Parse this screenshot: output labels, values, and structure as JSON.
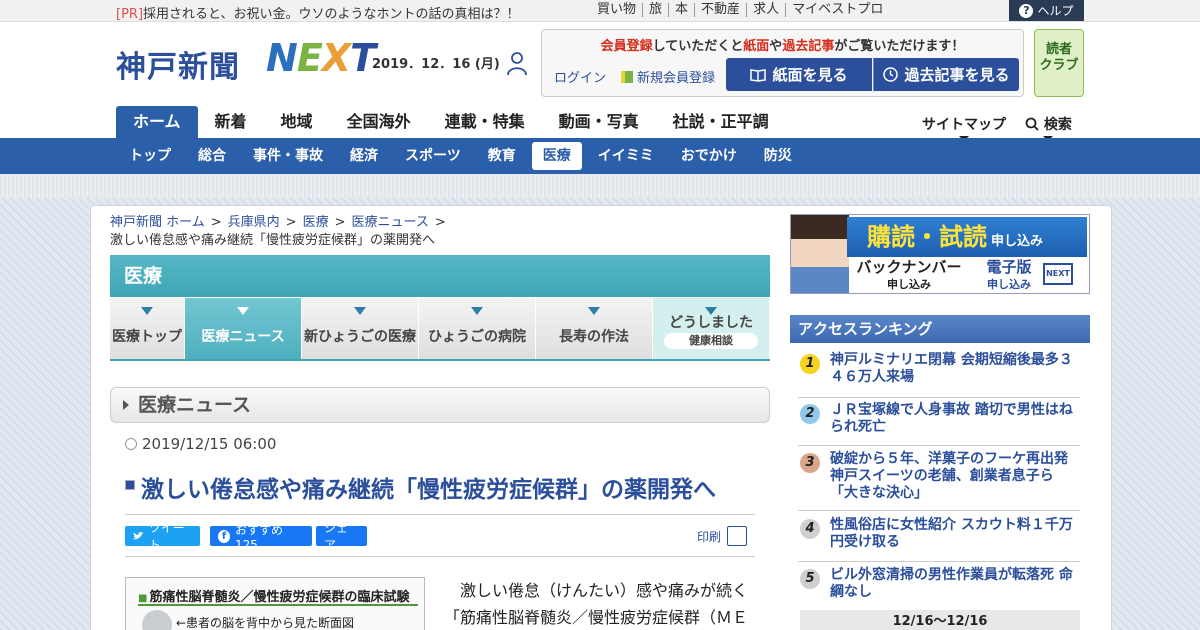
{
  "topbar": {
    "pr_tag": "[PR]",
    "pr_text": "採用されると、お祝い金。ウソのようなホントの話の真相は？！",
    "links": [
      "買い物",
      "旅",
      "本",
      "不動産",
      "求人",
      "マイベストプロ"
    ],
    "help": "ヘルプ"
  },
  "header": {
    "logo_text": "神戸新聞",
    "logo_next": {
      "n": "N",
      "e": "E",
      "x": "X",
      "t": "T"
    },
    "date": "2019．12．16 (月)",
    "member_msg": {
      "a": "会員登録",
      "b": "していただくと",
      "c": "紙面",
      "d": "や",
      "e": "過去記事",
      "f": "がご覧いただけます！"
    },
    "login": "ログイン",
    "register": "新規会員登録",
    "btn_paper": "紙面を見る",
    "btn_past": "過去記事を見る",
    "reader_club_1": "読者",
    "reader_club_2": "クラブ"
  },
  "mainnav": [
    "ホーム",
    "新着",
    "地域",
    "全国海外",
    "連載・特集",
    "動画・写真",
    "社説・正平調"
  ],
  "util": {
    "sitemap": "サイトマップ",
    "search": "検索"
  },
  "subnav": [
    "トップ",
    "総合",
    "事件・事故",
    "経済",
    "スポーツ",
    "教育",
    "医療",
    "イイミミ",
    "おでかけ",
    "防災"
  ],
  "breadcrumb": {
    "items": [
      "神戸新聞 ホーム",
      "兵庫県内",
      "医療",
      "医療ニュース"
    ],
    "sep": ">",
    "current": "激しい倦怠感や痛み継続「慢性疲労症候群」の薬開発へ"
  },
  "section_title": "医療",
  "subtabs": [
    "医療トップ",
    "医療ニュース",
    "新ひょうごの医療",
    "ひょうごの病院",
    "長寿の作法"
  ],
  "consult": {
    "main": "どうしました",
    "small": "健康相談"
  },
  "news_head": "医療ニュース",
  "article": {
    "timestamp": "2019/12/15 06:00",
    "headline": "激しい倦怠感や痛み継続「慢性疲労症候群」の薬開発へ",
    "share_tweet": "ツイート",
    "share_fb": "おすすめ 125",
    "share_fb_icon": "f",
    "share_share": "シェア",
    "print": "印刷",
    "figure_caption": "筋痛性脳脊髄炎／慢性疲労症候群の臨床試験",
    "figure_note": "←患者の脳を背中から見た断面図",
    "body": "　激しい倦怠（けんたい）感や痛みが続く「筋痛性脳脊髄炎／慢性疲労症候群（ＭＥ"
  },
  "ad": {
    "title": "購読・試読",
    "title_small": "申し込み",
    "backnumber": "バックナンバー",
    "backnumber_small": "申し込み",
    "digital": "電子版",
    "digital_small": "申し込み",
    "next_icon": "NEXT"
  },
  "ranking": {
    "title": "アクセスランキング",
    "items": [
      {
        "rank": "1",
        "text": "神戸ルミナリエ閉幕 会期短縮後最多３４６万人来場"
      },
      {
        "rank": "2",
        "text": "ＪＲ宝塚線で人身事故 踏切で男性はねられ死亡"
      },
      {
        "rank": "3",
        "text": "破綻から５年、洋菓子のフーケ再出発 神戸スイーツの老舗、創業者息子ら「大きな決心」"
      },
      {
        "rank": "4",
        "text": "性風俗店に女性紹介 スカウト料１千万円受け取る"
      },
      {
        "rank": "5",
        "text": "ビル外窓清掃の男性作業員が転落死 命綱なし"
      }
    ],
    "period": "12/16～12/16"
  },
  "colors": {
    "brand_blue": "#2c5faa",
    "section_teal": "#3ea5b5",
    "alert_red": "#d62c1a"
  }
}
